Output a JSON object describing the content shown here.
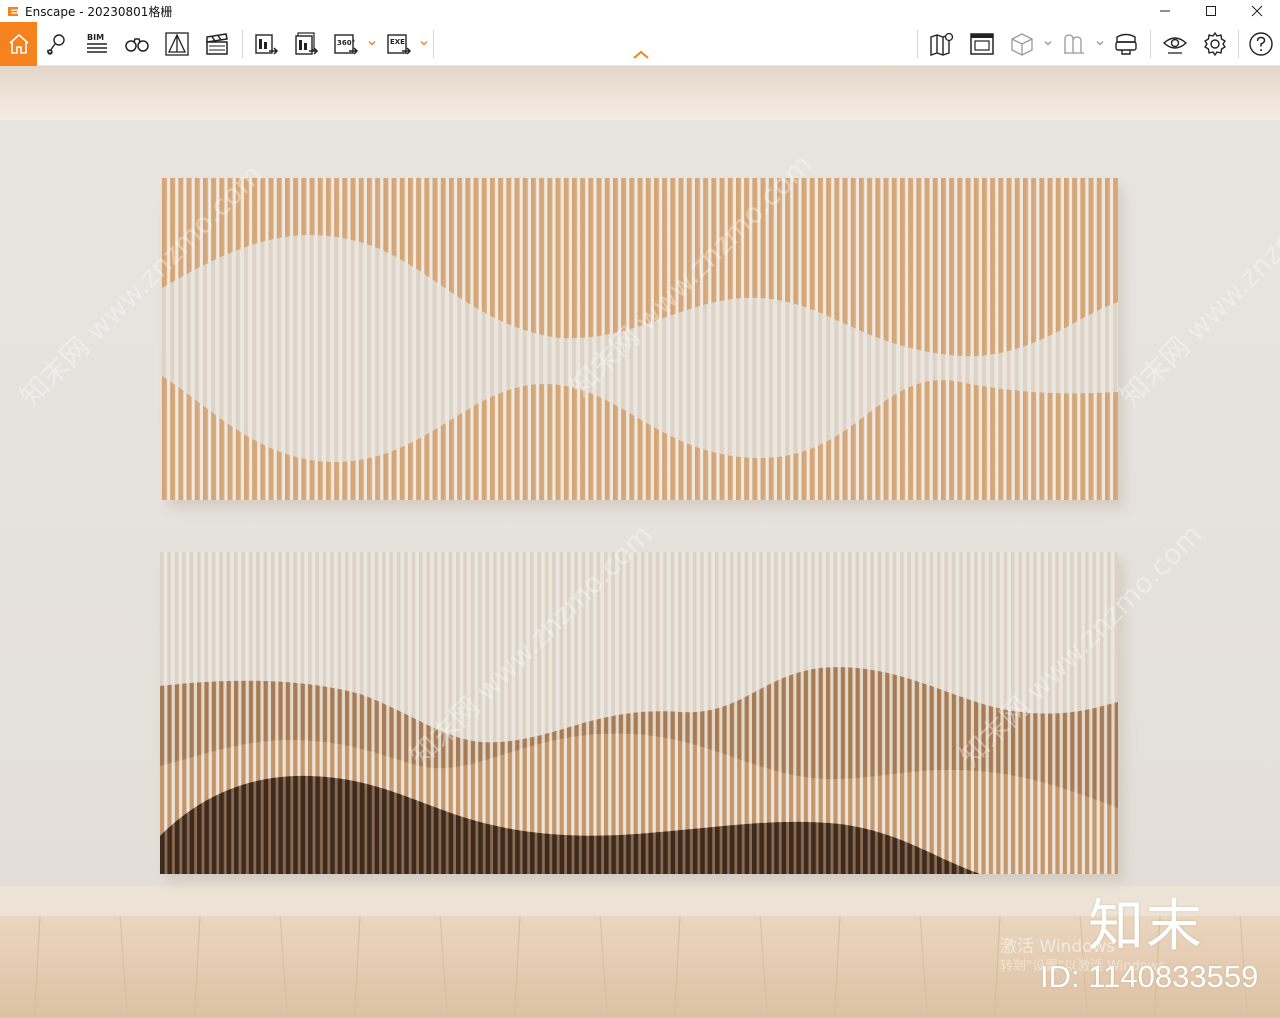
{
  "window": {
    "app_name": "Enscape",
    "title": "Enscape - 20230801格栅",
    "controls": [
      "minimize-icon",
      "maximize-icon",
      "close-icon"
    ]
  },
  "toolbar": {
    "home_icon": "home-icon",
    "left_tools": [
      {
        "name": "views-icon"
      },
      {
        "name": "bim-icon",
        "label": "BIM"
      },
      {
        "name": "binoculars-icon"
      },
      {
        "name": "pyramid-icon"
      },
      {
        "name": "clapperboard-icon"
      }
    ],
    "export_tools": [
      {
        "name": "render-export-icon"
      },
      {
        "name": "batch-export-icon"
      },
      {
        "name": "panorama-export-icon",
        "label": "360°"
      },
      {
        "name": "exe-export-icon",
        "label": "EXE"
      }
    ],
    "right_tools": [
      {
        "name": "map-icon"
      },
      {
        "name": "atlas-icon"
      },
      {
        "name": "cube-icon"
      },
      {
        "name": "asset-library-icon"
      },
      {
        "name": "vr-headset-icon"
      },
      {
        "name": "visual-settings-icon"
      },
      {
        "name": "settings-icon"
      },
      {
        "name": "help-icon"
      }
    ],
    "collapse_icon": "chevron-up-icon",
    "accent": "#f5821f"
  },
  "scene": {
    "watermark_text": "知末网 www.znzmo.com",
    "brand_mark": "知末",
    "asset_id": "ID: 1140833559",
    "activation_line1": "激活 Windows",
    "activation_line2": "转到\"设置\"以激活 Windows。",
    "colors": {
      "wall": "#e6e2dc",
      "ceiling": "#e9ddd0",
      "floor": "#e2cbb0",
      "wood_light": "#d7ae82",
      "wood_mid": "#c8956a",
      "wood_dark": "#4a3426",
      "panel_gap": "#efece7"
    }
  }
}
